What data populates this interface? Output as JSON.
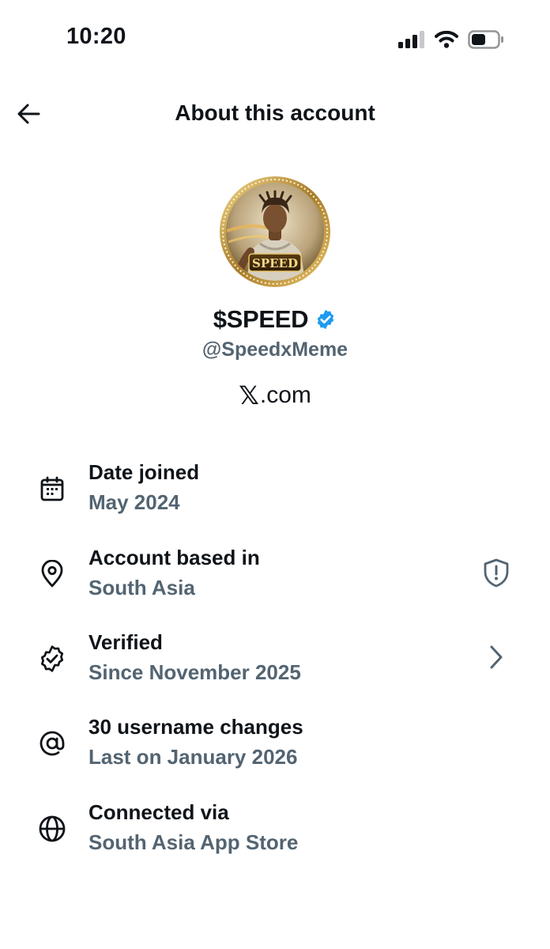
{
  "status_bar": {
    "time": "10:20"
  },
  "header": {
    "title": "About this account"
  },
  "profile": {
    "avatar_text": "SPEED",
    "display_name": "$SPEED",
    "verified": true,
    "handle": "@SpeedxMeme",
    "site_x": "𝕏",
    "site_rest": ".com"
  },
  "info": [
    {
      "icon": "calendar-icon",
      "title": "Date joined",
      "value": "May 2024"
    },
    {
      "icon": "location-pin-icon",
      "title": "Account based in",
      "value": "South Asia",
      "trailing_icon": "shield-alert-icon"
    },
    {
      "icon": "verified-badge-outline-icon",
      "title": "Verified",
      "value": "Since November 2025",
      "trailing_icon": "chevron-right-icon"
    },
    {
      "icon": "at-sign-icon",
      "title": "30 username changes",
      "value": "Last on January 2026"
    },
    {
      "icon": "globe-icon",
      "title": "Connected via",
      "value": "South Asia App Store"
    }
  ],
  "colors": {
    "text_primary": "#0f1419",
    "text_secondary": "#536471",
    "verified_blue": "#1d9bf0",
    "avatar_gold": "#c9a24a"
  }
}
